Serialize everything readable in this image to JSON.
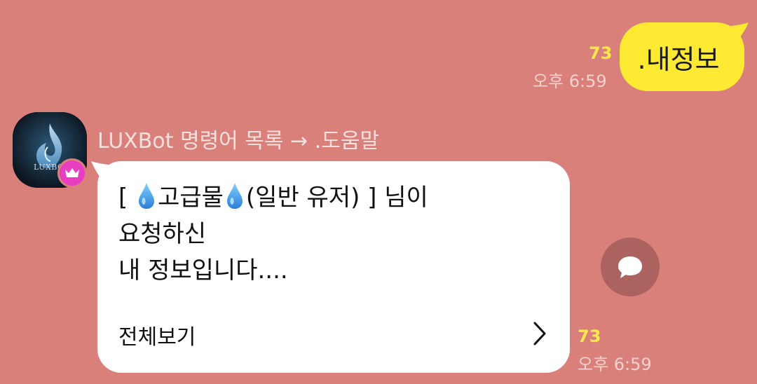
{
  "outgoing": {
    "text": ".내정보",
    "unread": "73",
    "time": "오후 6:59"
  },
  "incoming": {
    "avatar_text": "LUXBOT",
    "sender": "LUXBot 명령어 목록 → .도움말",
    "line1_pre": "[ ",
    "line1_word": "고급물",
    "line1_post": "(일반 유저) ] 님이",
    "line2": "요청하신",
    "line3": "내 정보입니다....",
    "view_all": "전체보기",
    "unread": "73",
    "time": "오후 6:59"
  },
  "icons": {
    "water": "water-drop-icon",
    "crown": "crown-icon",
    "chevron": "chevron-right-icon",
    "share": "speech-bubble-icon"
  },
  "colors": {
    "background": "#d9807a",
    "outgoing_bubble": "#fee933",
    "incoming_bubble": "#ffffff",
    "unread": "#ffe94a",
    "crown_badge": "#ea3ec2"
  }
}
